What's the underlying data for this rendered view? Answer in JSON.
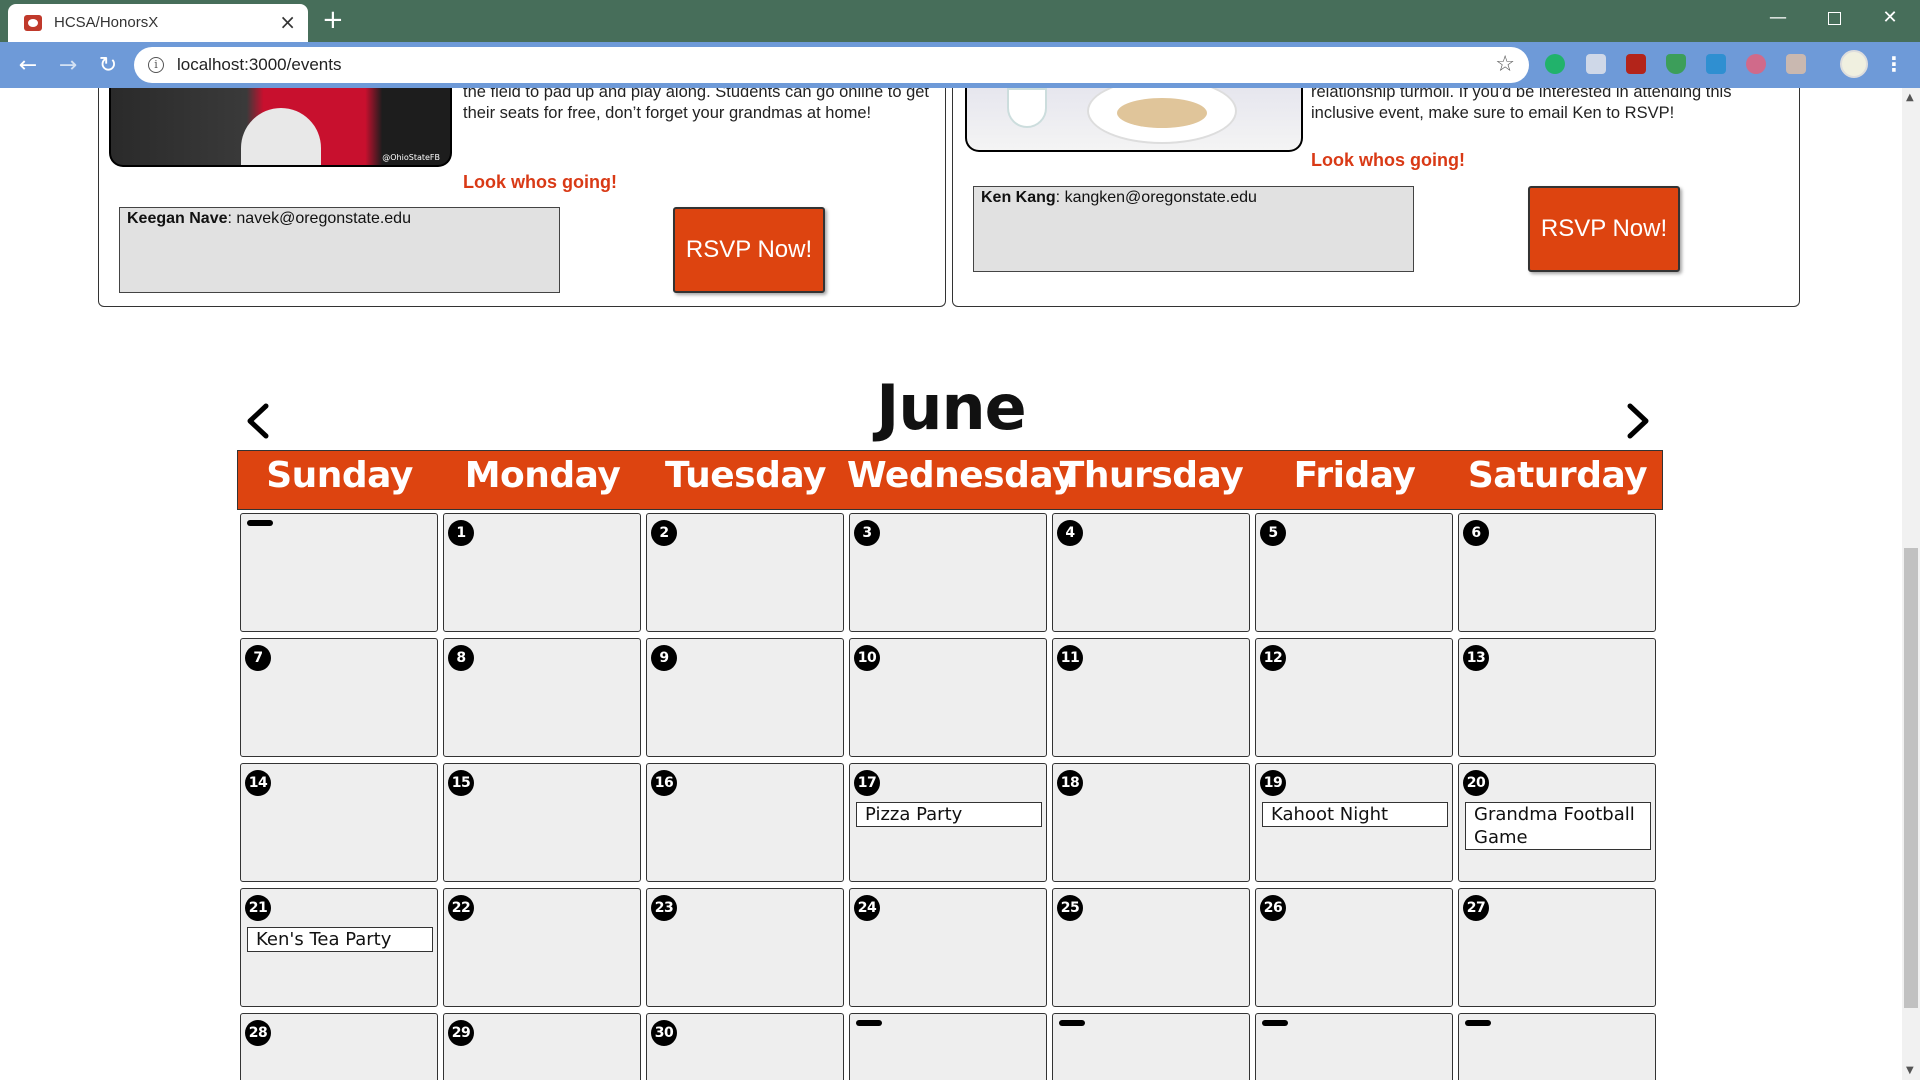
{
  "browser": {
    "tab_title": "HCSA/HonorsX",
    "tab_close": "×",
    "new_tab": "+",
    "url": "localhost:3000/events",
    "icons": [
      "back-icon",
      "forward-icon",
      "reload-icon",
      "info-icon",
      "star-icon",
      "grammarly-icon",
      "reader-icon",
      "acrobat-icon",
      "shield-icon",
      "extension-icon",
      "glasses-icon",
      "puzzle-icon",
      "profile-icon",
      "menu-icon"
    ]
  },
  "events": [
    {
      "description_visible": "the field to pad up and play along. Students can go online to get their seats for free, don’t forget your grandmas at home!",
      "image_watermark": "@OhioStateFB",
      "whos_going_label": "Look whos going!",
      "attendee_name": "Keegan Nave",
      "attendee_email": "navek@oregonstate.edu",
      "rsvp_label": "RSVP Now!"
    },
    {
      "description_visible": "relationship turmoil. If you'd be interested in attending this inclusive event, make sure to email Ken to RSVP!",
      "whos_going_label": "Look whos going!",
      "attendee_name": "Ken Kang",
      "attendee_email": "kangken@oregonstate.edu",
      "rsvp_label": "RSVP Now!"
    }
  ],
  "calendar": {
    "month": "June",
    "accent_color": "#dd4410",
    "days_of_week": [
      "Sunday",
      "Monday",
      "Tuesday",
      "Wednesday",
      "Thursday",
      "Friday",
      "Saturday"
    ],
    "weeks": [
      [
        {
          "day": ""
        },
        {
          "day": "1"
        },
        {
          "day": "2"
        },
        {
          "day": "3"
        },
        {
          "day": "4"
        },
        {
          "day": "5"
        },
        {
          "day": "6"
        }
      ],
      [
        {
          "day": "7"
        },
        {
          "day": "8"
        },
        {
          "day": "9"
        },
        {
          "day": "10"
        },
        {
          "day": "11"
        },
        {
          "day": "12"
        },
        {
          "day": "13"
        }
      ],
      [
        {
          "day": "14"
        },
        {
          "day": "15"
        },
        {
          "day": "16"
        },
        {
          "day": "17",
          "event": "Pizza Party"
        },
        {
          "day": "18"
        },
        {
          "day": "19",
          "event": "Kahoot Night"
        },
        {
          "day": "20",
          "event": "Grandma Football Game"
        }
      ],
      [
        {
          "day": "21",
          "event": "Ken's Tea Party"
        },
        {
          "day": "22"
        },
        {
          "day": "23"
        },
        {
          "day": "24"
        },
        {
          "day": "25"
        },
        {
          "day": "26"
        },
        {
          "day": "27"
        }
      ],
      [
        {
          "day": "28"
        },
        {
          "day": "29"
        },
        {
          "day": "30"
        },
        {
          "day": ""
        },
        {
          "day": ""
        },
        {
          "day": ""
        },
        {
          "day": ""
        }
      ]
    ]
  }
}
